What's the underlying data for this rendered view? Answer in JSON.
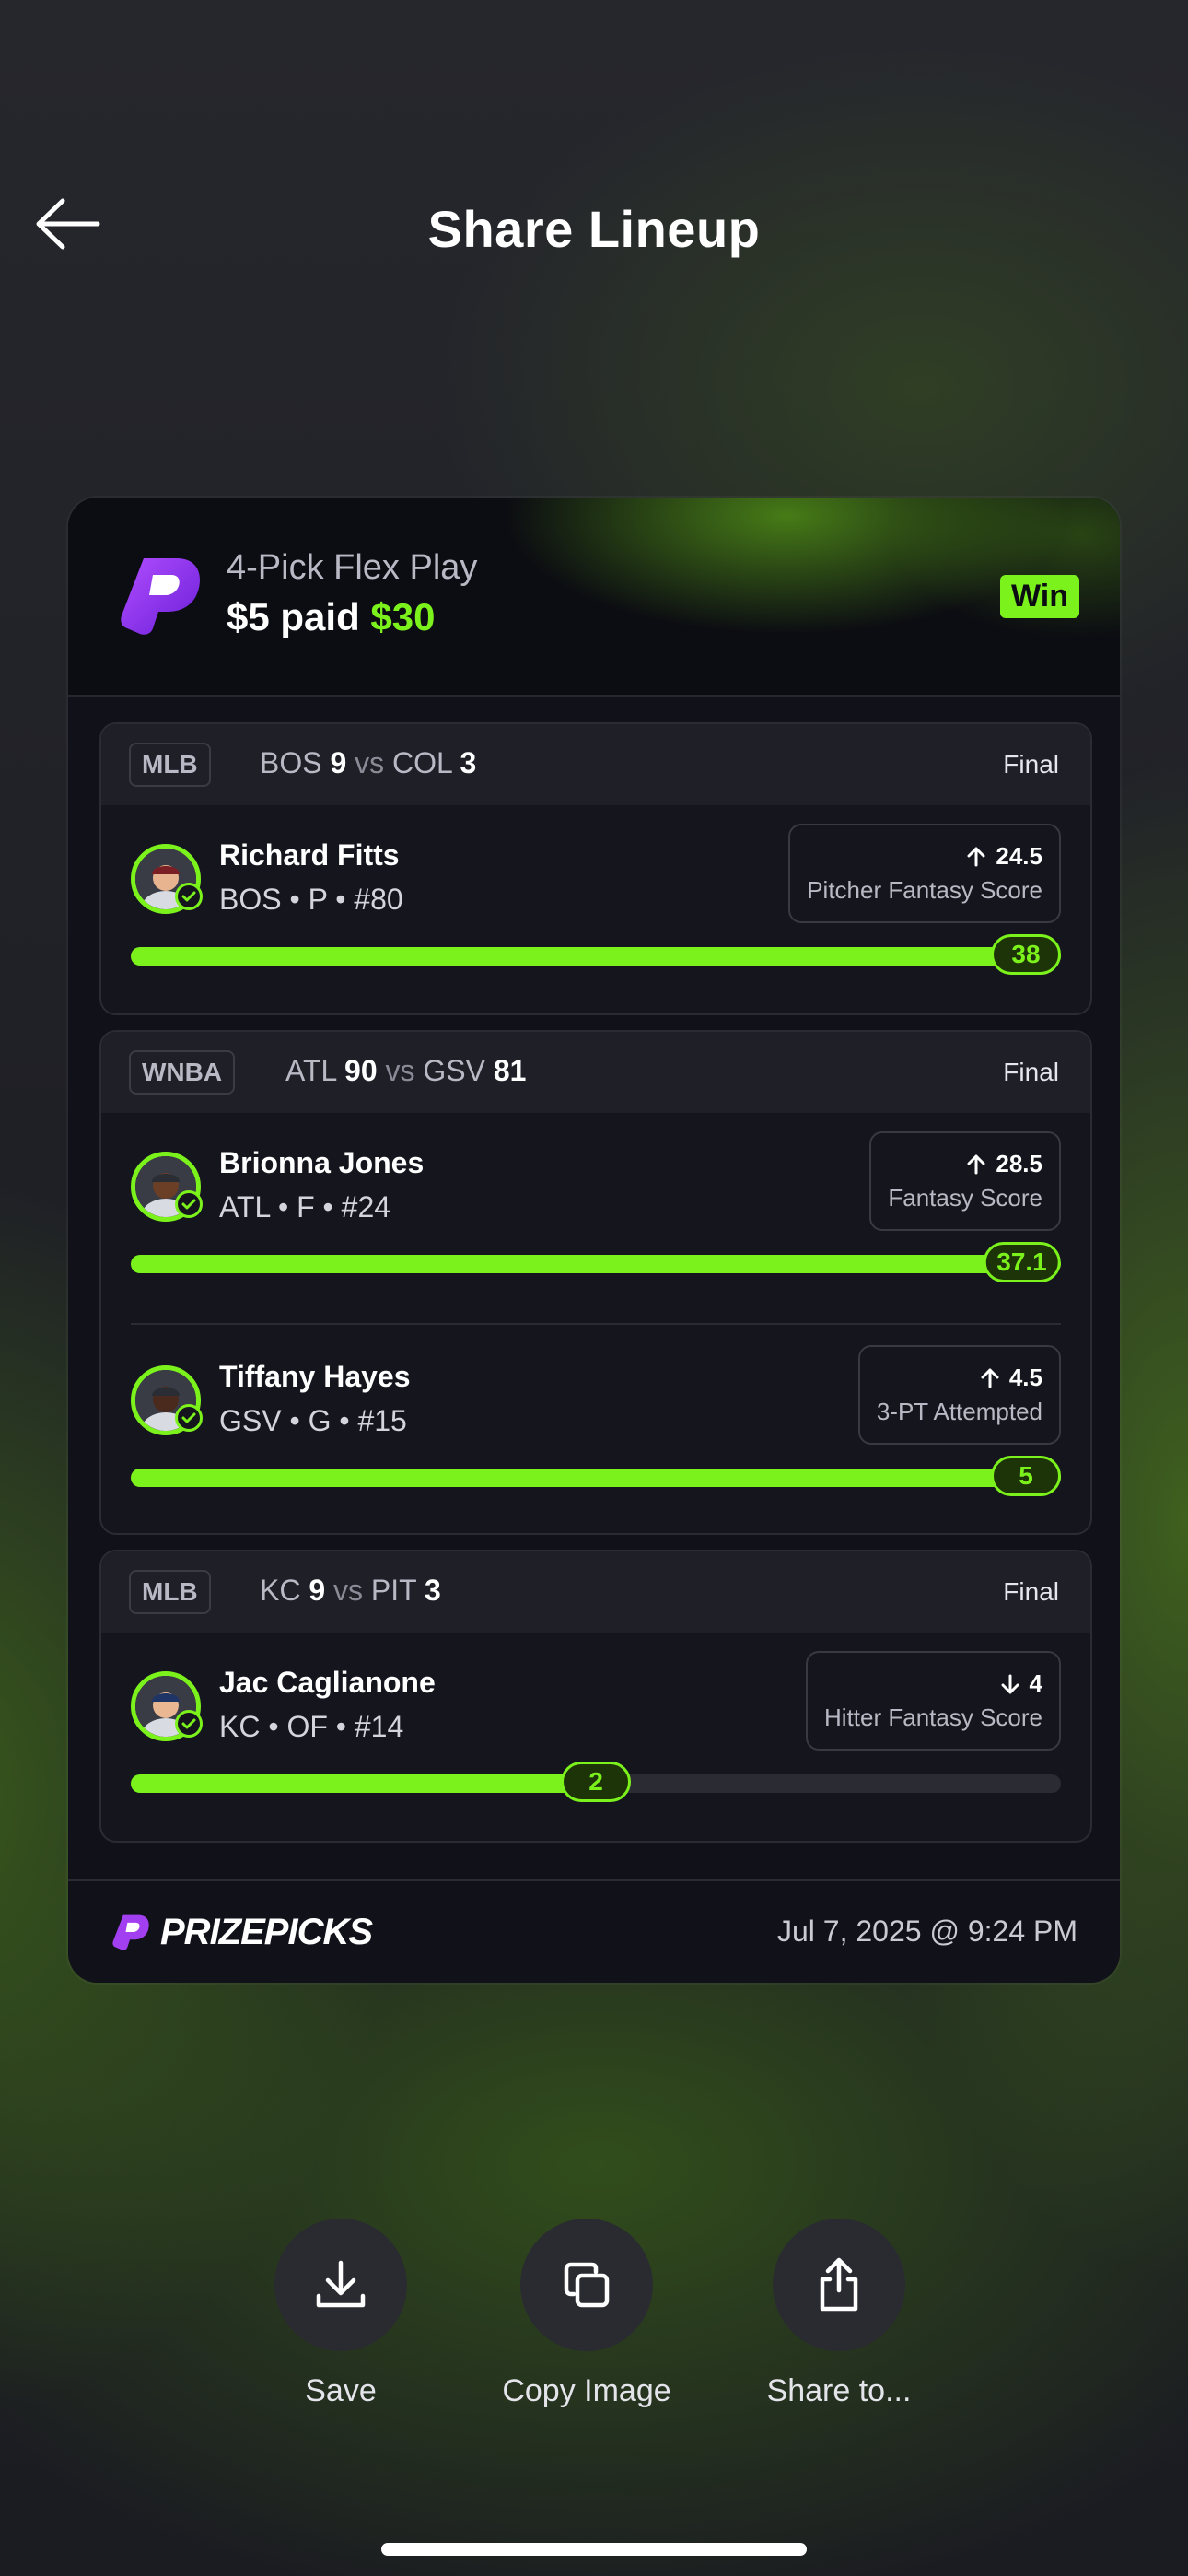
{
  "header": {
    "title": "Share Lineup"
  },
  "card": {
    "play_type": "4-Pick Flex Play",
    "payout_prefix": "$5 paid",
    "payout_amount": "$30",
    "result_badge": "Win",
    "footer_brand": "PRIZEPICKS",
    "timestamp": "Jul 7, 2025 @ 9:24 PM"
  },
  "games": [
    {
      "league": "MLB",
      "team1": "BOS",
      "score1": "9",
      "vs": "vs",
      "team2": "COL",
      "score2": "3",
      "status": "Final",
      "picks": [
        {
          "name": "Richard Fitts",
          "info": "BOS • P • #80",
          "line": "24.5",
          "direction": "up",
          "stat": "Pitcher Fantasy Score",
          "result": "38",
          "progress": 1.0
        }
      ]
    },
    {
      "league": "WNBA",
      "team1": "ATL",
      "score1": "90",
      "vs": "vs",
      "team2": "GSV",
      "score2": "81",
      "status": "Final",
      "picks": [
        {
          "name": "Brionna Jones",
          "info": "ATL • F • #24",
          "line": "28.5",
          "direction": "up",
          "stat": "Fantasy Score",
          "result": "37.1",
          "progress": 1.0
        },
        {
          "name": "Tiffany Hayes",
          "info": "GSV • G • #15",
          "line": "4.5",
          "direction": "up",
          "stat": "3-PT Attempted",
          "result": "5",
          "progress": 1.0
        }
      ]
    },
    {
      "league": "MLB",
      "team1": "KC",
      "score1": "9",
      "vs": "vs",
      "team2": "PIT",
      "score2": "3",
      "status": "Final",
      "picks": [
        {
          "name": "Jac Caglianone",
          "info": "KC • OF • #14",
          "line": "4",
          "direction": "down",
          "stat": "Hitter Fantasy Score",
          "result": "2",
          "progress": 0.5
        }
      ]
    }
  ],
  "actions": {
    "save_label": "Save",
    "copy_label": "Copy Image",
    "share_label": "Share to..."
  },
  "colors": {
    "accent": "#7cf21c",
    "card_bg": "#111219",
    "brand": "#8a2be2"
  }
}
